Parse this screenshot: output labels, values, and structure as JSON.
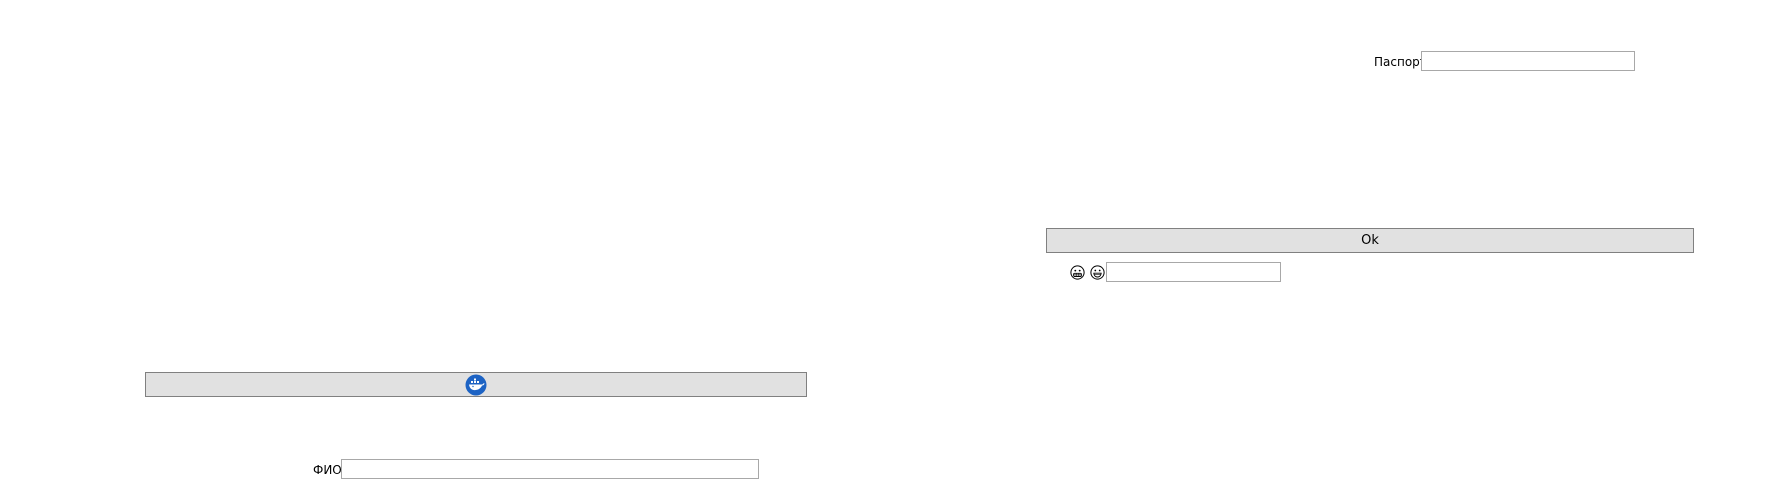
{
  "left_panel": {
    "button_icon": "docker-whale-icon",
    "button_icon_color": "#1d63c4",
    "fio_label": "ФИО",
    "fio_value": ""
  },
  "right_panel": {
    "passport_label": "Паспорт",
    "passport_value": "",
    "ok_label": "Ok",
    "emoji_icons": [
      "grimacing-face-icon",
      "grinning-face-icon"
    ],
    "emoji_field_value": ""
  }
}
